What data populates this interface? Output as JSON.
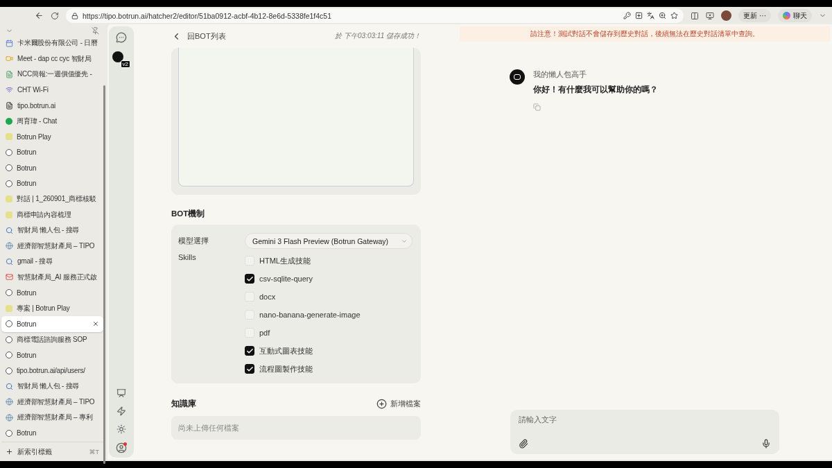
{
  "browser": {
    "url": "https://tipo.botrun.ai/hatcher2/editor/51ba0912-acbf-4b12-8e6d-5338fe1f4c51",
    "update_button": "更新 ···",
    "chat_button": "聊天"
  },
  "tabs": [
    {
      "title": "卡米爾股份有限公司 - 日曆",
      "kind": "calendar",
      "selected": false
    },
    {
      "title": "Meet - dap cc cyc 智財局",
      "kind": "meet",
      "selected": false
    },
    {
      "title": "NCC簡報:一週價值優先 -",
      "kind": "sheet",
      "selected": false
    },
    {
      "title": "CHT Wi-Fi",
      "kind": "wifi",
      "selected": false
    },
    {
      "title": "tipo.botrun.ai",
      "kind": "page",
      "selected": false
    },
    {
      "title": "周育瑋 - Chat",
      "kind": "chat",
      "selected": false
    },
    {
      "title": "Botrun Play",
      "kind": "play",
      "selected": false
    },
    {
      "title": "Botrun",
      "kind": "botrun",
      "selected": false
    },
    {
      "title": "Botrun",
      "kind": "botrun",
      "selected": false
    },
    {
      "title": "Botrun",
      "kind": "botrun",
      "selected": false
    },
    {
      "title": "對話 | 1_260901_商標核駁",
      "kind": "play",
      "selected": false
    },
    {
      "title": "商標申請內容梳理",
      "kind": "play",
      "selected": false
    },
    {
      "title": "智財局 懶人包 - 搜尋",
      "kind": "search",
      "selected": false
    },
    {
      "title": "經濟部智慧財產局 – TIPO",
      "kind": "globe",
      "selected": false
    },
    {
      "title": "gmail - 搜尋",
      "kind": "search",
      "selected": false
    },
    {
      "title": "智慧財產局_AI 服務正式啟",
      "kind": "mail",
      "selected": false
    },
    {
      "title": "Botrun",
      "kind": "botrun",
      "selected": false
    },
    {
      "title": "專案 | Botrun Play",
      "kind": "play",
      "selected": false
    },
    {
      "title": "Botrun",
      "kind": "botrun",
      "selected": true
    },
    {
      "title": "商標電話諮詢服務 SOP",
      "kind": "botrun",
      "selected": false
    },
    {
      "title": "Botrun",
      "kind": "botrun",
      "selected": false
    },
    {
      "title": "tipo.botrun.ai/api/users/",
      "kind": "botrun",
      "selected": false
    },
    {
      "title": "智財局 懶人包 - 搜尋",
      "kind": "search",
      "selected": false
    },
    {
      "title": "經濟部智慧財產局 – TIPO",
      "kind": "globe",
      "selected": false
    },
    {
      "title": "經濟部智慧財產局 – 專利",
      "kind": "globe",
      "selected": false
    },
    {
      "title": "Botrun",
      "kind": "botrun",
      "selected": false
    }
  ],
  "new_tab": {
    "label": "新索引標籤",
    "shortcut": "⌘T"
  },
  "rail": {
    "version_badge": "v2"
  },
  "editor": {
    "back_label": "回BOT列表",
    "save_status": "於 下午03:03:11 儲存成功！",
    "mechanism": {
      "title": "BOT機制",
      "model_label": "模型選擇",
      "model_value": "Gemini 3 Flash Preview (Botrun Gateway)",
      "skills_label": "Skills",
      "skills": [
        {
          "name": "HTML生成技能",
          "checked": false
        },
        {
          "name": "csv-sqlite-query",
          "checked": true
        },
        {
          "name": "docx",
          "checked": false
        },
        {
          "name": "nano-banana-generate-image",
          "checked": false
        },
        {
          "name": "pdf",
          "checked": false
        },
        {
          "name": "互動式圖表技能",
          "checked": true
        },
        {
          "name": "流程圖製作技能",
          "checked": true
        }
      ]
    },
    "knowledge": {
      "title": "知識庫",
      "add_button": "新增檔案",
      "empty_text": "尚未上傳任何檔案"
    }
  },
  "chat": {
    "notice": "請注意！測試對話不會儲存到歷史對話，後續無法在歷史對話清單中查詢。",
    "messages": [
      {
        "sender": "我的懶人包高手",
        "text": "你好！有什麼我可以幫助你的嗎？"
      }
    ],
    "input": {
      "placeholder": "請輸入文字"
    }
  }
}
